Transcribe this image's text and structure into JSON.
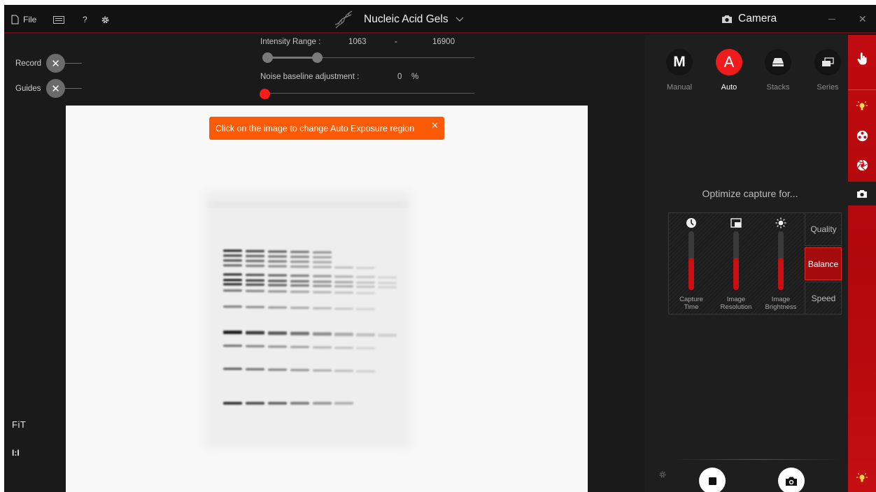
{
  "titlebar": {
    "file_label": "File",
    "help_label": "?",
    "app_title": "Nucleic Acid Gels",
    "camera_title": "Camera",
    "close_label": "✕"
  },
  "left_tools": {
    "record_label": "Record",
    "guides_label": "Guides",
    "toggle_symbol": "✕",
    "fit_label": "FiT",
    "one_one_label": "I:I"
  },
  "sliders": {
    "intensity_label": "Intensity Range :",
    "intensity_min": "1063",
    "intensity_dash": "-",
    "intensity_max": "16900",
    "noise_label": "Noise baseline adjustment :",
    "noise_value": "0",
    "noise_unit": "%"
  },
  "tooltip": {
    "text": "Click on the image to change Auto Exposure region",
    "close": "✕"
  },
  "modes": [
    {
      "letter": "M",
      "label": "Manual"
    },
    {
      "letter": "A",
      "label": "Auto"
    },
    {
      "letter": "",
      "label": "Stacks"
    },
    {
      "letter": "",
      "label": "Series"
    }
  ],
  "optimize": {
    "title": "Optimize capture for...",
    "metrics": [
      {
        "label_1": "Capture",
        "label_2": "Time",
        "level": 0.55
      },
      {
        "label_1": "Image",
        "label_2": "Resolution",
        "level": 0.55
      },
      {
        "label_1": "Image",
        "label_2": "Brightness",
        "level": 0.55
      }
    ],
    "presets": [
      "Quality",
      "Balance",
      "Speed"
    ],
    "selected_preset": "Balance"
  },
  "colors": {
    "accent_red": "#ee1c1c",
    "tooltip_orange": "#fb5a06",
    "rail_red": "#c10b10",
    "panel_bg": "#1e1e1e"
  },
  "icons": {
    "file": "file-icon",
    "keyboard": "keyboard-icon",
    "settings": "gear-icon",
    "dna": "dna-icon",
    "camera": "camera-icon",
    "touch": "touch-icon",
    "light": "lightbulb-icon",
    "filter": "filter-wheel-icon",
    "aperture": "aperture-icon"
  }
}
